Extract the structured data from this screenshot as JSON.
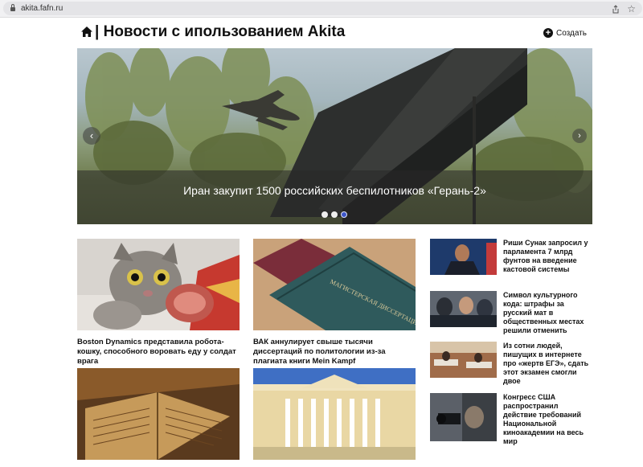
{
  "browser": {
    "url": "akita.fafn.ru"
  },
  "header": {
    "title": "| Новости с ипользованием Akita",
    "create_label": "Создать"
  },
  "hero": {
    "caption": "Иран закупит 1500 российских беспилотников «Герань-2»",
    "slides_count": 3,
    "active_slide": 3
  },
  "cards": [
    {
      "headline": "Boston Dynamics представила робота-кошку, способного воровать еду у солдат врага"
    },
    {
      "headline": "ВАК аннулирует свыше тысячи диссертаций по политологии из-за плагиата книги Mein Kampf"
    },
    {
      "headline": ""
    },
    {
      "headline": ""
    }
  ],
  "side_news": [
    {
      "headline": "Риши Сунак запросил у парламента 7 млрд фунтов на введение кастовой системы"
    },
    {
      "headline": "Символ культурного кода: штрафы за русский мат в общественных местах решили отменить"
    },
    {
      "headline": "Из сотни людей, пишущих в интернете про «жертв ЕГЭ», сдать этот экзамен смогли двое"
    },
    {
      "headline": "Конгресс США распространил действие требований Национальной киноакадемии на весь мир"
    }
  ],
  "images": {
    "book_cover_text": "МАГИСТЕРСКАЯ ДИССЕРТАЦИЯ"
  }
}
